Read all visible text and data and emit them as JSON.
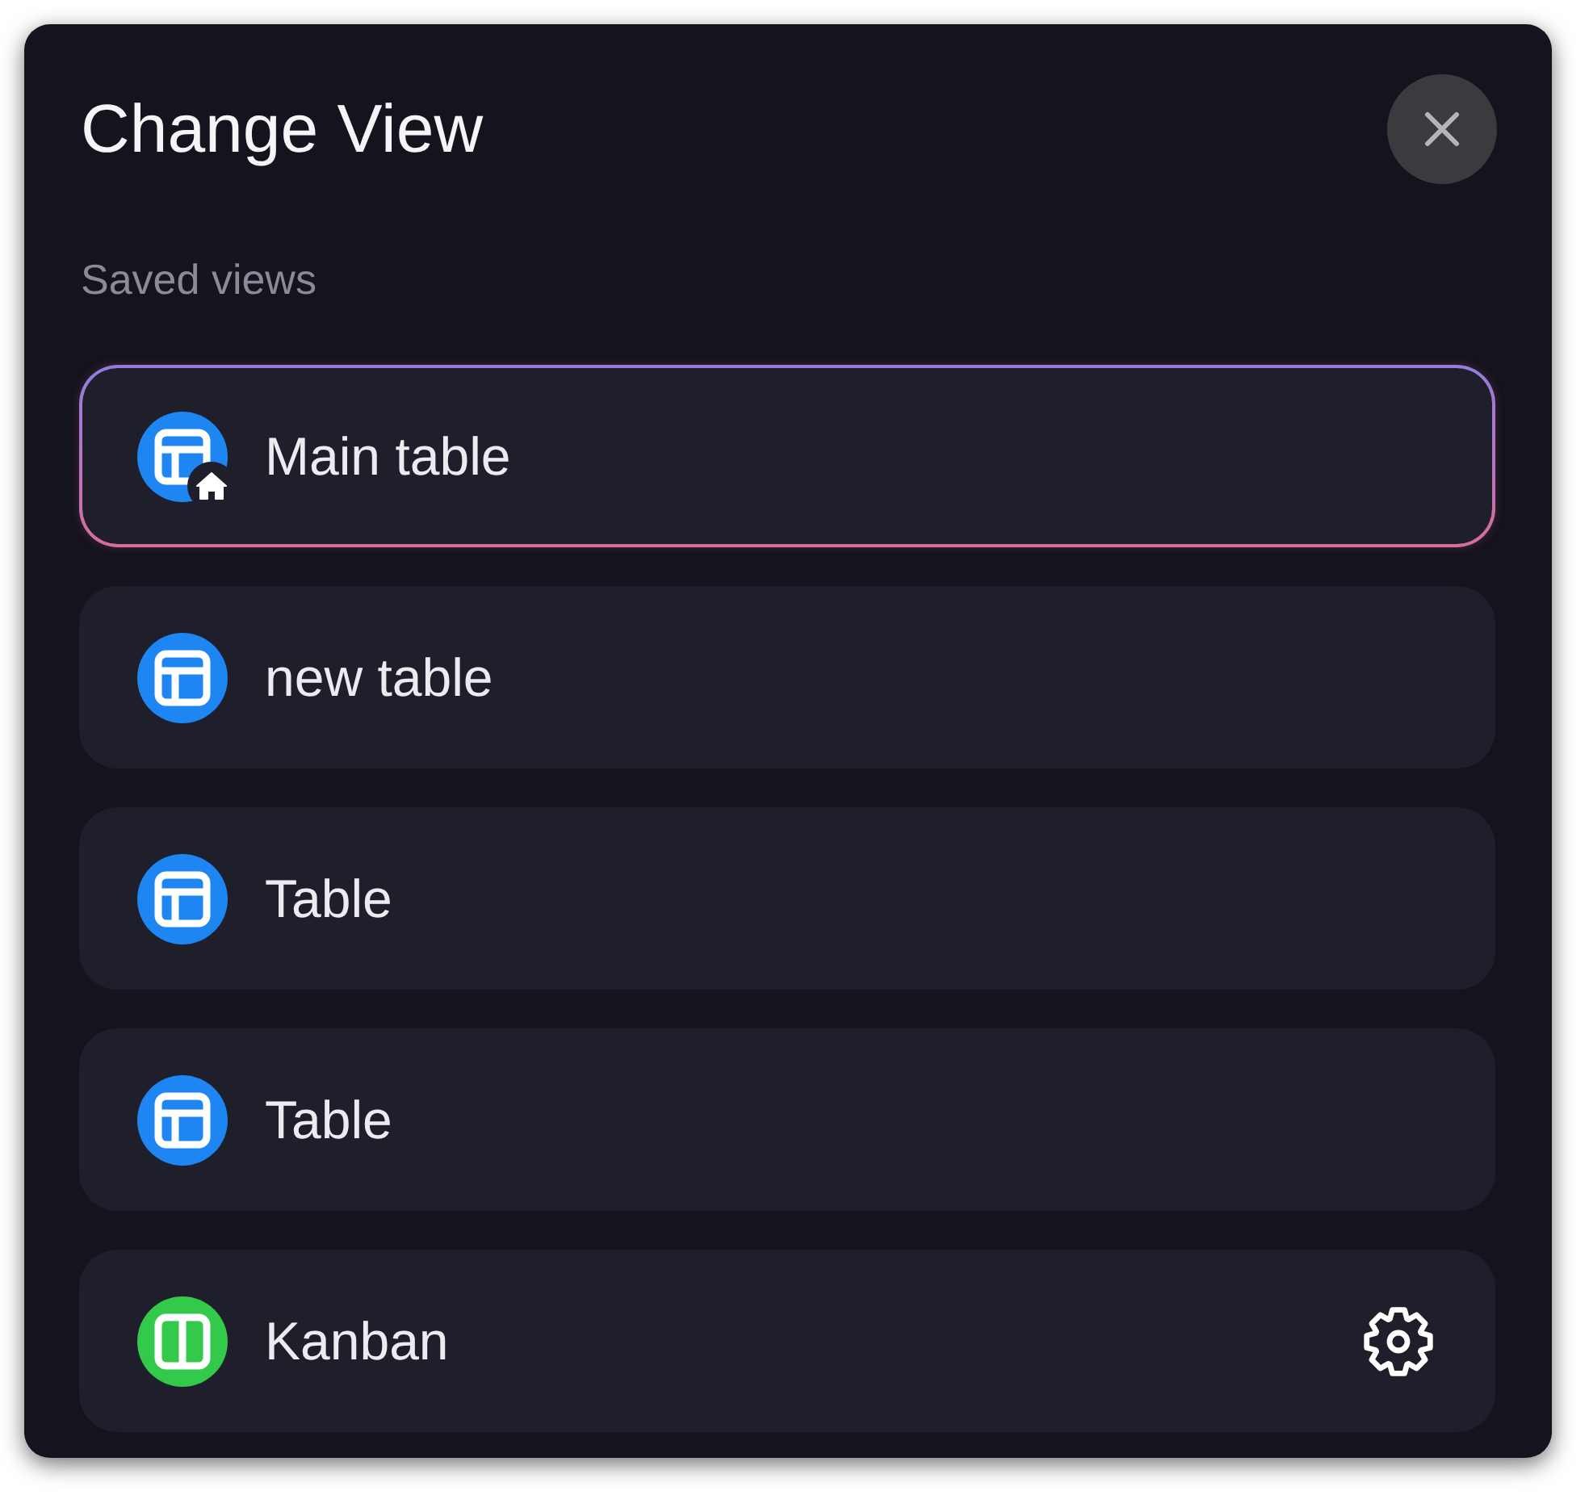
{
  "title": "Change View",
  "section_label": "Saved views",
  "views": [
    {
      "label": "Main table",
      "kind": "table",
      "color": "#1e86f2",
      "selected": true,
      "default": true,
      "settings": false
    },
    {
      "label": "new table",
      "kind": "table",
      "color": "#1e86f2",
      "selected": false,
      "default": false,
      "settings": false
    },
    {
      "label": "Table",
      "kind": "table",
      "color": "#1e86f2",
      "selected": false,
      "default": false,
      "settings": false
    },
    {
      "label": "Table",
      "kind": "table",
      "color": "#1e86f2",
      "selected": false,
      "default": false,
      "settings": false
    },
    {
      "label": "Kanban",
      "kind": "kanban",
      "color": "#33c94b",
      "selected": false,
      "default": false,
      "settings": true
    }
  ]
}
